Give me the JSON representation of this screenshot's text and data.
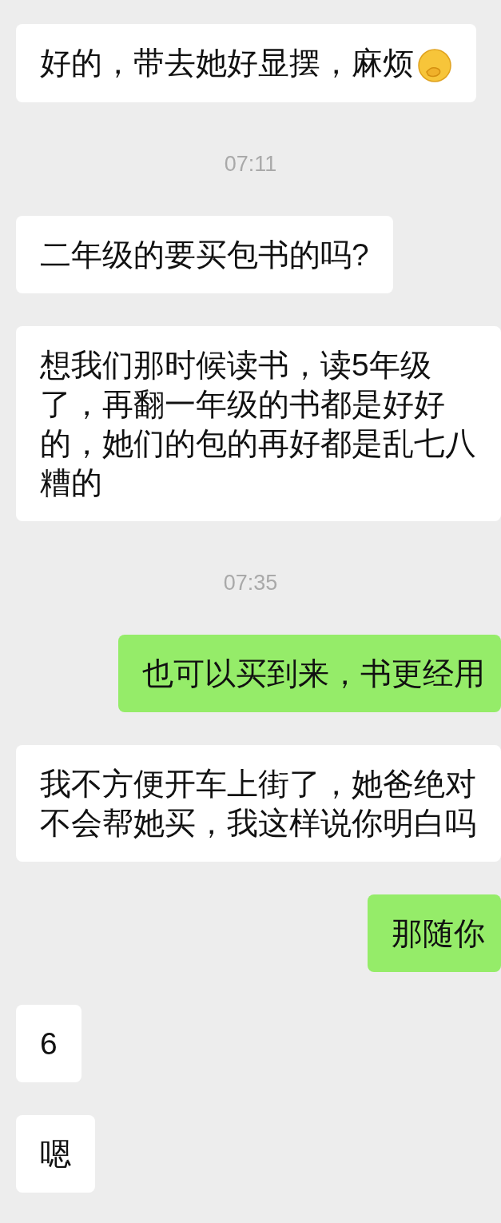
{
  "messages": [
    {
      "kind": "incoming",
      "text": "好的，带去她好显摆，麻烦",
      "has_emoji": true
    },
    {
      "kind": "time",
      "text": "07:11"
    },
    {
      "kind": "incoming",
      "text": "二年级的要买包书的吗?",
      "has_emoji": false
    },
    {
      "kind": "incoming",
      "text": "想我们那时候读书，读5年级了，再翻一年级的书都是好好的，她们的包的再好都是乱七八糟的",
      "has_emoji": false
    },
    {
      "kind": "time",
      "text": "07:35"
    },
    {
      "kind": "outgoing",
      "text": "也可以买到来，书更经用",
      "has_emoji": false
    },
    {
      "kind": "incoming",
      "text": "我不方便开车上街了，她爸绝对不会帮她买，我这样说你明白吗",
      "has_emoji": false
    },
    {
      "kind": "outgoing",
      "text": "那随你",
      "has_emoji": false
    },
    {
      "kind": "incoming",
      "text": "6",
      "has_emoji": false
    },
    {
      "kind": "incoming",
      "text": "嗯",
      "has_emoji": false
    }
  ]
}
